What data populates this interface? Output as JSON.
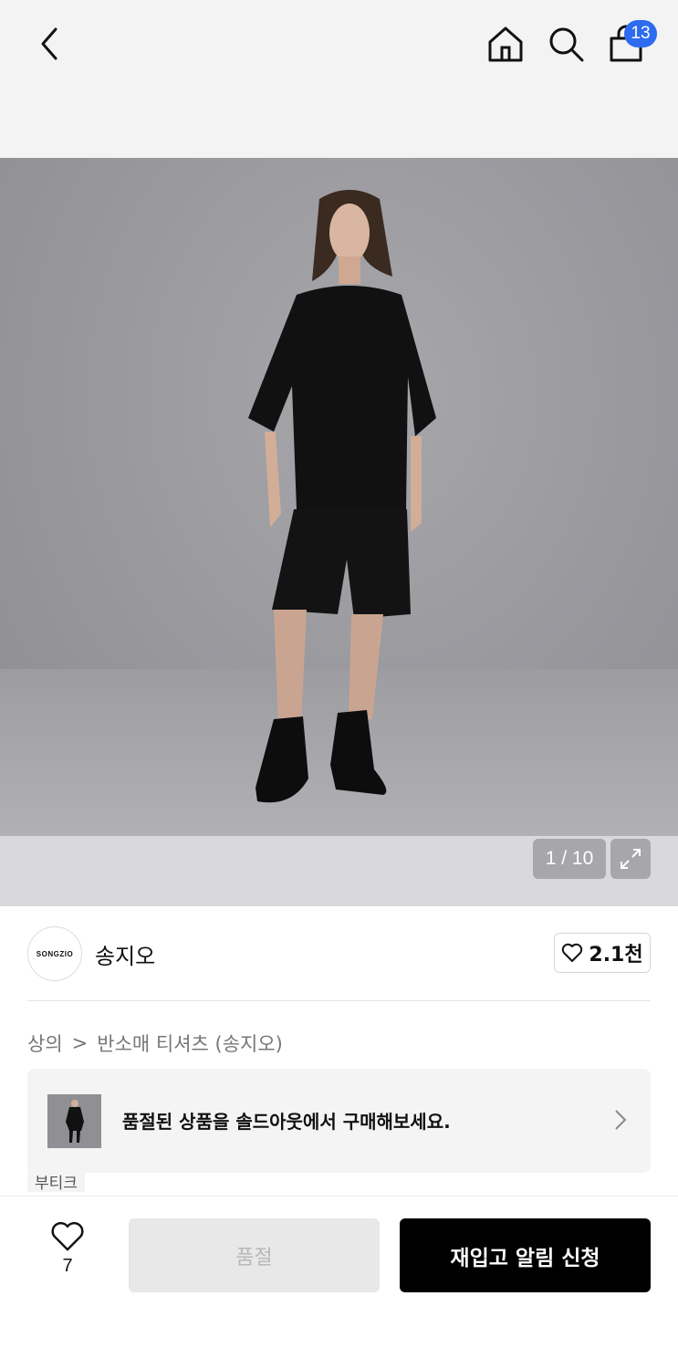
{
  "header": {
    "cart_count": "13",
    "icons": [
      "chevron-left-icon",
      "home-icon",
      "search-icon",
      "shopping-bag-icon"
    ]
  },
  "gallery": {
    "counter": "1 / 10"
  },
  "brand": {
    "logo_text": "SONGZIO",
    "name": "송지오",
    "like_count": "2.1천"
  },
  "breadcrumb": {
    "category": "상의",
    "separator": ">",
    "subcategory": "반소매 티셔츠 (송지오)"
  },
  "promo": {
    "text": "품절된 상품을 솔드아웃에서 구매해보세요.",
    "tag": "부티크"
  },
  "bottom": {
    "wish_count": "7",
    "soldout_label": "품절",
    "restock_label": "재입고 알림 신청"
  }
}
